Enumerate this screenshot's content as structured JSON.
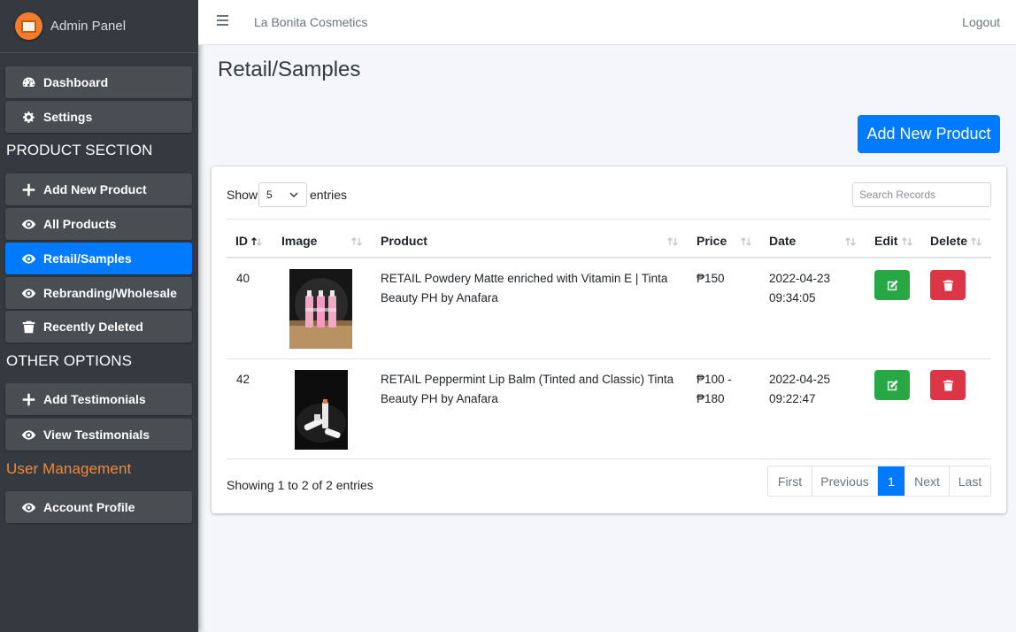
{
  "sidebar": {
    "brand": "Admin Panel",
    "items": [
      {
        "label": "Dashboard",
        "icon": "tachometer-icon"
      },
      {
        "label": "Settings",
        "icon": "gear-icon"
      },
      {
        "label": "Add New Product",
        "icon": "plus-icon"
      },
      {
        "label": "All Products",
        "icon": "eye-icon"
      },
      {
        "label": "Retail/Samples",
        "icon": "eye-icon",
        "active": true
      },
      {
        "label": "Rebranding/Wholesale",
        "icon": "eye-icon"
      },
      {
        "label": "Recently Deleted",
        "icon": "trash-icon"
      },
      {
        "label": "Add Testimonials",
        "icon": "plus-icon"
      },
      {
        "label": "View Testimonials",
        "icon": "eye-icon"
      },
      {
        "label": "Account Profile",
        "icon": "eye-icon"
      }
    ],
    "headers": {
      "product": "PRODUCT SECTION",
      "other": "OTHER OPTIONS",
      "user": "User Management"
    },
    "accent_active": "#007bff",
    "accent_user": "#f08a3c"
  },
  "topbar": {
    "title": "La Bonita Cosmetics",
    "logout": "Logout"
  },
  "page": {
    "title": "Retail/Samples",
    "add_button": "Add New Product"
  },
  "table_controls": {
    "show": "Show",
    "entries": "entries",
    "page_size": "5",
    "search_placeholder": "Search Records"
  },
  "columns": [
    "ID",
    "Image",
    "Product",
    "Price",
    "Date",
    "Edit",
    "Delete"
  ],
  "rows": [
    {
      "id": "40",
      "product_line1": "RETAIL Powdery Matte enriched with Vitamin E | Tinta",
      "product_line2": "Beauty PH by Anafara",
      "price_line1": "₱150",
      "price_line2": "",
      "date_line1": "2022-04-23",
      "date_line2": "09:34:05"
    },
    {
      "id": "42",
      "product_line1": "RETAIL Peppermint Lip Balm (Tinted and Classic) Tinta",
      "product_line2": "Beauty PH by Anafara",
      "price_line1": "₱100 -",
      "price_line2": "₱180",
      "date_line1": "2022-04-25",
      "date_line2": "09:22:47"
    }
  ],
  "footer": {
    "info": "Showing 1 to 2 of 2 entries",
    "pager": [
      "First",
      "Previous",
      "1",
      "Next",
      "Last"
    ],
    "current_page": "1"
  }
}
